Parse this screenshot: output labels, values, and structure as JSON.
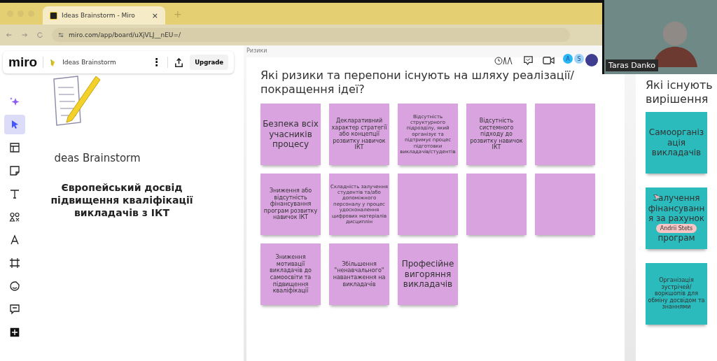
{
  "browser": {
    "tab_title": "Ideas Brainstorm - Miro",
    "tab_close": "×",
    "new_tab": "+",
    "url": "miro.com/app/board/uXjVLJ__nEU=/"
  },
  "toolbar": {
    "logo": "miro",
    "board_name": "Ideas Brainstorm",
    "menu": "⋮",
    "upgrade": "Upgrade"
  },
  "tools": [
    {
      "kind": "sparkle",
      "selected": false
    },
    {
      "kind": "select",
      "selected": true
    },
    {
      "kind": "layout",
      "selected": false
    },
    {
      "kind": "sticky",
      "selected": false
    },
    {
      "kind": "text",
      "selected": false
    },
    {
      "kind": "shapes",
      "selected": false
    },
    {
      "kind": "pen",
      "selected": false
    },
    {
      "kind": "frame",
      "selected": false
    },
    {
      "kind": "sticker",
      "selected": false
    },
    {
      "kind": "comment",
      "selected": false
    },
    {
      "kind": "plus",
      "selected": false
    }
  ],
  "avatars": [
    {
      "kind": "letter",
      "initial": "A",
      "color": "#29b6f6"
    },
    {
      "kind": "letter",
      "initial": "S",
      "color": "#9fd3f5"
    },
    {
      "kind": "photo",
      "color": "#3f3d8f"
    }
  ],
  "video": {
    "name": "Taras Danko"
  },
  "cover": {
    "title": "deas Brainstorm",
    "subtitle": "Європейський досвід підвищення кваліфікації викладачів з ІКТ"
  },
  "frames": [
    {
      "label": "Ризики",
      "question": "Які ризики та перепони існують на шляху реалізації/ покращення ідеї?",
      "notes": [
        {
          "text": "Безпека всіх учасників процесу",
          "color": "#d9a3e0"
        },
        {
          "text": "Декларативний характер стратегії або концепції розвитку навичок ІКТ",
          "color": "#d9a3e0"
        },
        {
          "text": "Відсутність структурного підрозділу, який організує та підтримує процес підготовки викладачів/студентів",
          "color": "#d9a3e0"
        },
        {
          "text": "Відсутність системного підходу до розвитку навичок ІКТ",
          "color": "#d9a3e0"
        },
        {
          "color": "#d9a3e0"
        },
        {
          "text": "Зниження або відсутність фінансування програм розвитку навичок ІКТ",
          "color": "#d9a3e0"
        },
        {
          "text": "Складність залучення студентів та/або допоміжного персоналу у процес удосконалення цифрових матеріалів дисциплін",
          "color": "#d9a3e0"
        },
        {
          "color": "#d9a3e0"
        },
        {
          "color": "#d9a3e0"
        },
        {
          "color": "#d9a3e0"
        },
        {
          "text": "Зниження мотивації викладачів до самоосвіти та підвищення кваліфікації",
          "color": "#d9a3e0"
        },
        {
          "text": "Збільшення \"ненавчального\" навантаження на викладачів",
          "color": "#d9a3e0"
        },
        {
          "text": "Професійне вигоряння викладачів",
          "color": "#d9a3e0"
        }
      ]
    },
    {
      "question": "Які існують вирішення",
      "notes": [
        {
          "text": "Самоорганізація викладачів",
          "color": "#2bbbbd"
        },
        {
          "text": "Залучення фінансування за рахунок",
          "cursor": "Andrii Stets",
          "text_after": "програм",
          "color": "#2bbbbd"
        },
        {
          "text": "Організація зустрічей/ воркшопів для обміну досвідом та знаннями",
          "color": "#2bbbbd"
        }
      ]
    }
  ]
}
